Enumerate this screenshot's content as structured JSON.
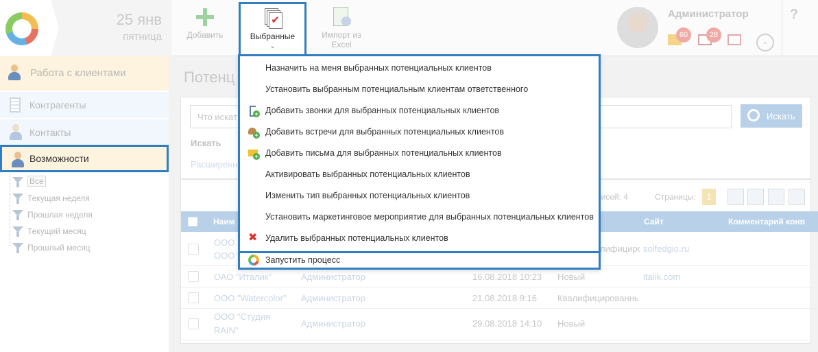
{
  "header": {
    "date": "25 янв",
    "weekday": "пятница",
    "add_label": "Добавить",
    "favorites_label": "Выбранные",
    "import_label_1": "Импорт из",
    "import_label_2": "Excel",
    "user_name": "Администратор",
    "mail_count": "60",
    "task_count": "28",
    "help": "?"
  },
  "sidebar": {
    "section": "Работа с клиентами",
    "items": [
      {
        "label": "Контрагенты"
      },
      {
        "label": "Контакты"
      },
      {
        "label": "Возможности"
      }
    ],
    "filters": [
      {
        "label": "Все"
      },
      {
        "label": "Текущая неделя"
      },
      {
        "label": "Прошлая неделя"
      },
      {
        "label": "Текущий месяц"
      },
      {
        "label": "Прошлый месяц"
      }
    ]
  },
  "main": {
    "title": "Потенц",
    "search_placeholder": "Что искат",
    "search_button": "Искать",
    "search_label": "Искать",
    "advanced": "Расширенн",
    "records": "писей: 4",
    "pages_label": "Страницы:",
    "page": "1",
    "columns": {
      "name": "Наим",
      "site": "Сайт",
      "comment": "Комментарий конв"
    },
    "rows": [
      {
        "name": "ООО \"Сол",
        "name2": "ООО",
        "owner": "",
        "date": "",
        "status": "лифицированне",
        "site": "solfedgio.ru"
      },
      {
        "name": "ОАО \"Италик\"",
        "owner": "Администратор",
        "date": "16.08.2018 10:23",
        "status": "Новый",
        "site": "italik.com"
      },
      {
        "name": "ООО \"Watercolor\"",
        "owner": "Администратор",
        "date": "21.08.2018 9:16",
        "status": "Квалифицированнь",
        "site": ""
      },
      {
        "name": "ООО \"Студия",
        "name2": "RAIN\"",
        "owner": "Администратор",
        "date": "29.08.2018 14:10",
        "status": "Новый",
        "site": ""
      }
    ]
  },
  "dropdown": {
    "items": [
      {
        "label": "Назначить на меня выбранных потенциальных клиентов",
        "icon": ""
      },
      {
        "label": "Установить выбранным потенциальным клиентам ответственного",
        "icon": ""
      },
      {
        "label": "Добавить звонки для выбранных потенциальных клиентов",
        "icon": "phone-add-icon"
      },
      {
        "label": "Добавить встречи для выбранных потенциальных клиентов",
        "icon": "meeting-add-icon"
      },
      {
        "label": "Добавить письма для выбранных потенциальных клиентов",
        "icon": "mail-add-icon"
      },
      {
        "label": "Активировать выбранных потенциальных клиентов",
        "icon": ""
      },
      {
        "label": "Изменить тип выбранных потенциальных клиентов",
        "icon": ""
      },
      {
        "label": "Установить маркетинговое мероприятие для выбранных потенциальных клиентов",
        "icon": ""
      },
      {
        "label": "Удалить выбранных потенциальных клиентов",
        "icon": "delete-icon"
      },
      {
        "label": "Запустить процесс",
        "icon": "process-icon"
      }
    ]
  },
  "colors": {
    "highlight": "#2f7ec1",
    "active_bg": "#fdf3df",
    "delete": "#d8342b"
  }
}
